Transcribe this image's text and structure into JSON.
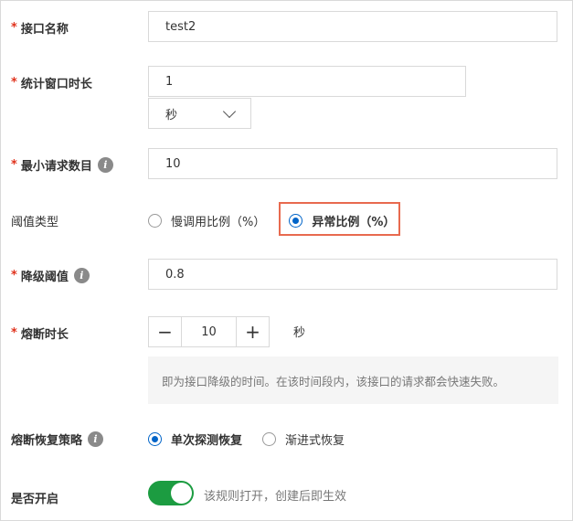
{
  "form": {
    "api_name": {
      "label": "接口名称",
      "required": "*",
      "value": "test2"
    },
    "stat_window": {
      "label": "统计窗口时长",
      "required": "*",
      "value": "1",
      "unit_selected": "秒"
    },
    "min_requests": {
      "label": "最小请求数目",
      "required": "*",
      "info_icon": "info-icon",
      "value": "10"
    },
    "threshold_type": {
      "label": "阈值类型",
      "options": [
        {
          "label": "慢调用比例（%）",
          "selected": false
        },
        {
          "label": "异常比例（%）",
          "selected": true
        }
      ]
    },
    "degrade_threshold": {
      "label": "降级阈值",
      "required": "*",
      "info_icon": "info-icon",
      "value": "0.8"
    },
    "break_duration": {
      "label": "熔断时长",
      "required": "*",
      "minus": "−",
      "plus": "+",
      "value": "10",
      "unit": "秒",
      "hint": "即为接口降级的时间。在该时间段内，该接口的请求都会快速失败。"
    },
    "recovery_strategy": {
      "label": "熔断恢复策略",
      "info_icon": "info-icon",
      "options": [
        {
          "label": "单次探测恢复",
          "selected": true
        },
        {
          "label": "渐进式恢复",
          "selected": false
        }
      ]
    },
    "enabled": {
      "label": "是否开启",
      "on": true,
      "hint": "该规则打开，创建后即生效"
    }
  },
  "colors": {
    "required": "#e0321c",
    "accent": "#0064c8",
    "toggle_on": "#1c9c41",
    "highlight": "#e86a4f"
  }
}
